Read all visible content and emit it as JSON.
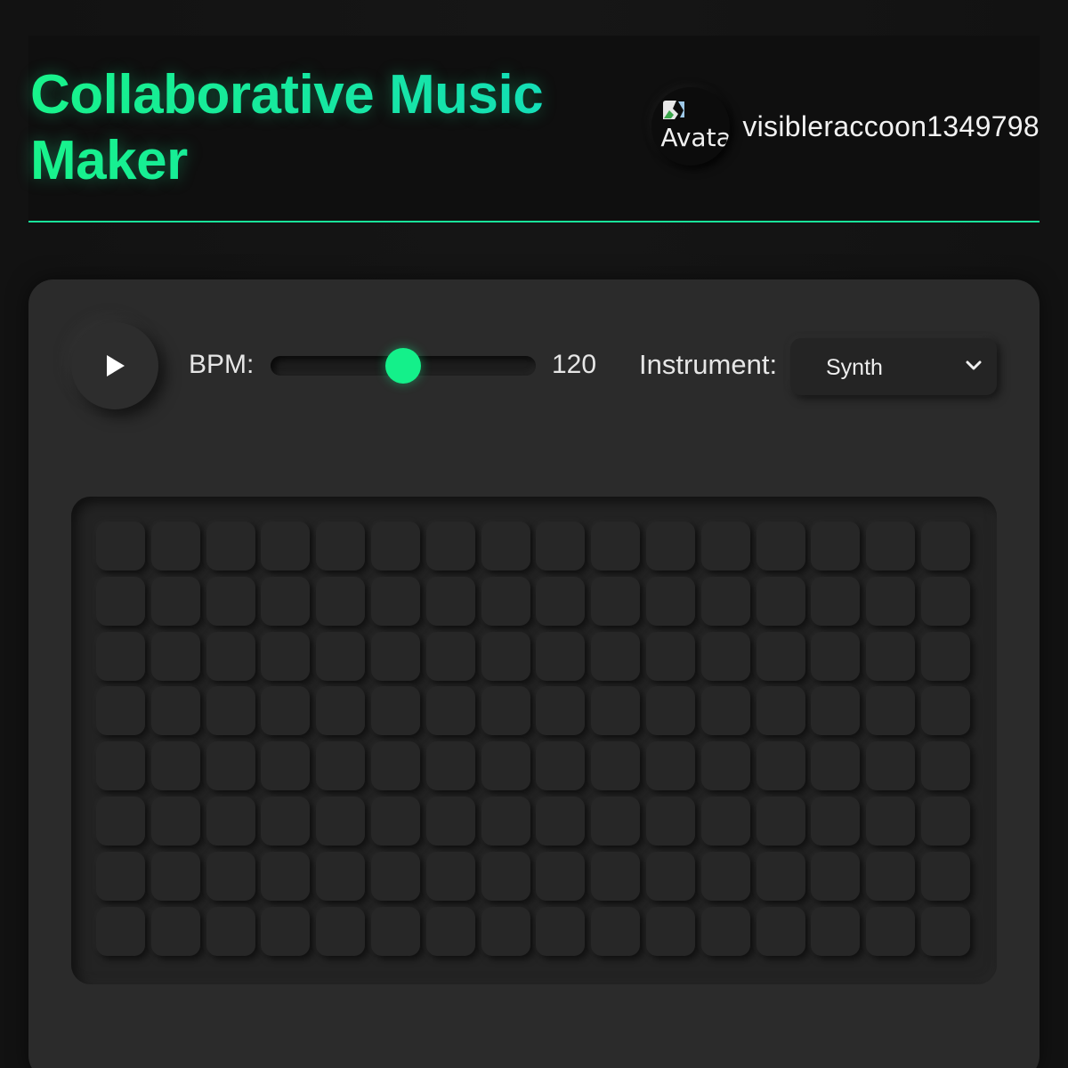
{
  "header": {
    "title": "Collaborative Music Maker",
    "avatar_alt": "Avatar",
    "username": "visibleraccoon1349798"
  },
  "controls": {
    "play_icon": "play-icon",
    "bpm_label": "BPM:",
    "bpm_value": "120",
    "bpm_min": 60,
    "bpm_max": 180,
    "instrument_label": "Instrument:",
    "instrument_selected": "Synth",
    "dropdown_icon": "chevron-down-icon"
  },
  "sequencer": {
    "rows": 8,
    "steps": 16,
    "active": []
  },
  "colors": {
    "accent": "#19e39a",
    "thumb": "#14f08a",
    "background": "#121212",
    "panel": "#2b2b2b"
  }
}
